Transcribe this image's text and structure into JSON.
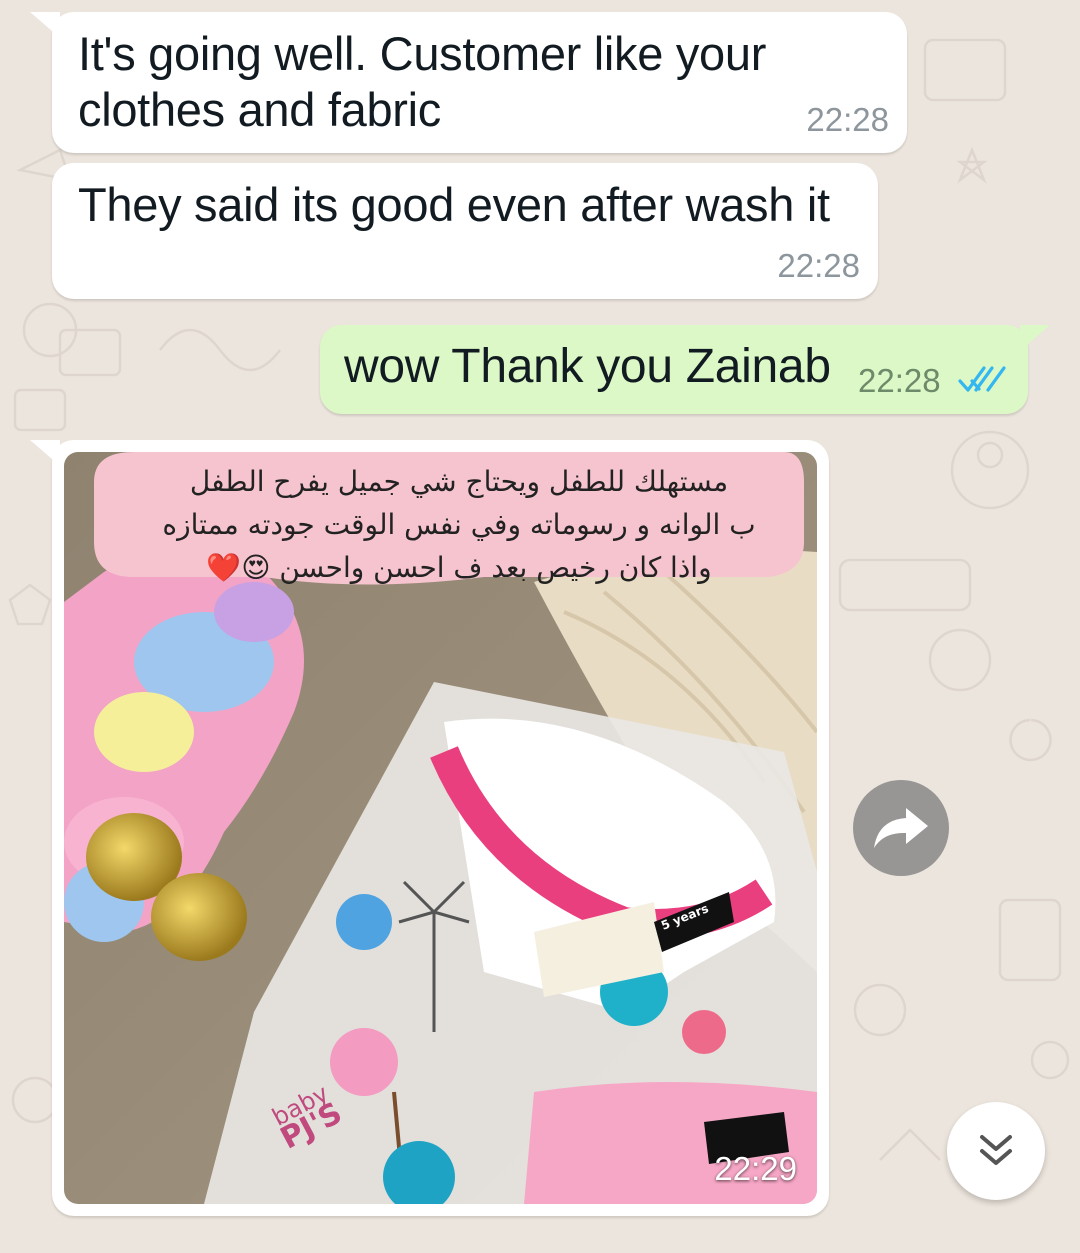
{
  "messages": [
    {
      "direction": "incoming",
      "text": "It's going well. Customer like your clothes and fabric",
      "time": "22:28"
    },
    {
      "direction": "incoming",
      "text": "They said its good even after wash it",
      "time": "22:28"
    },
    {
      "direction": "outgoing",
      "text": "wow Thank you Zainab",
      "time": "22:28",
      "status_icon": "double-check-read-icon"
    },
    {
      "direction": "incoming",
      "type": "image",
      "time": "22:29",
      "image": {
        "overlay_text_lines": [
          "مستهلك للطفل ويحتاج شي جميل يفرح الطفل",
          "ب الوانه و رسوماته وفي نفس الوقت جودته ممتازه",
          "واذا كان رخيص بعد ف احسن واحسن 😍❤️"
        ],
        "package_label_brand": "baby",
        "package_label_name": "PJ'S",
        "tag_text": "5 years"
      }
    }
  ],
  "buttons": {
    "forward_icon": "forward-arrow-icon",
    "scroll_down_icon": "double-chevron-down-icon"
  },
  "colors": {
    "chat_background": "#ece5dd",
    "incoming_bubble": "#ffffff",
    "outgoing_bubble": "#dcf8c6",
    "read_ticks": "#34b7f1"
  }
}
